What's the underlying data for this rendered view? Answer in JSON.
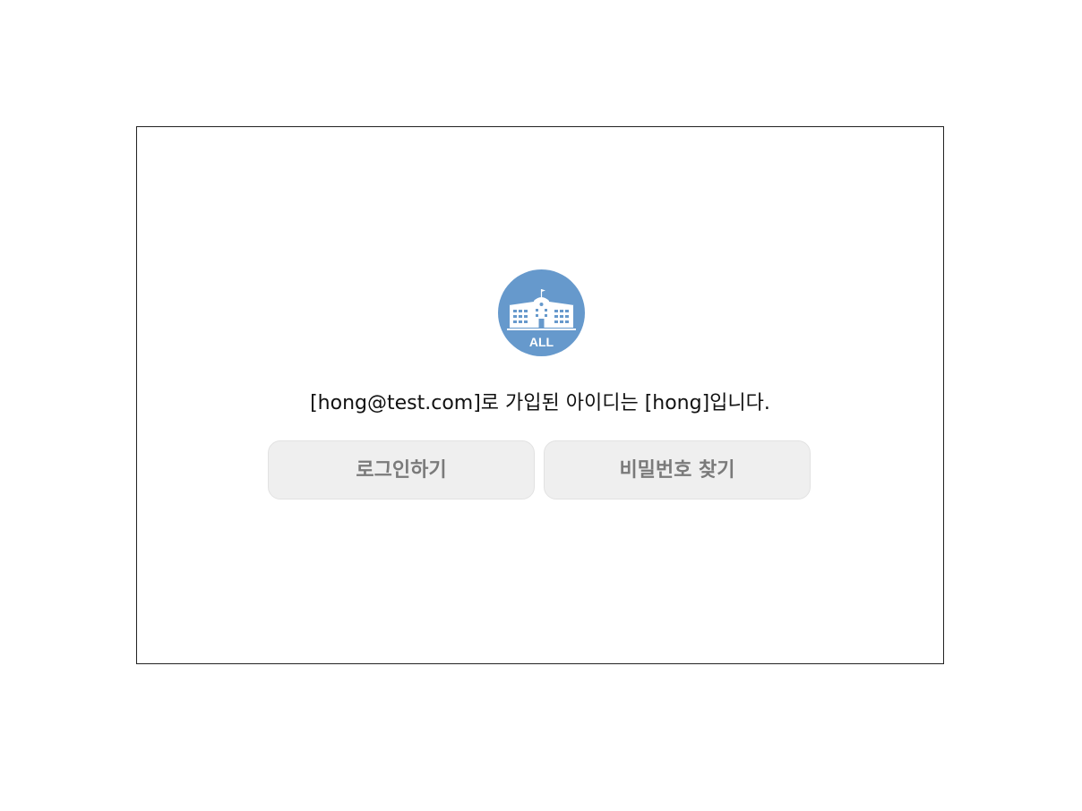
{
  "logo": {
    "icon": "school-building-icon",
    "text": "ALL",
    "color": "#6699cc"
  },
  "message": {
    "text": "[hong@test.com]로 가입된 아이디는 [hong]입니다."
  },
  "buttons": {
    "login_label": "로그인하기",
    "find_password_label": "비밀번호 찾기"
  }
}
